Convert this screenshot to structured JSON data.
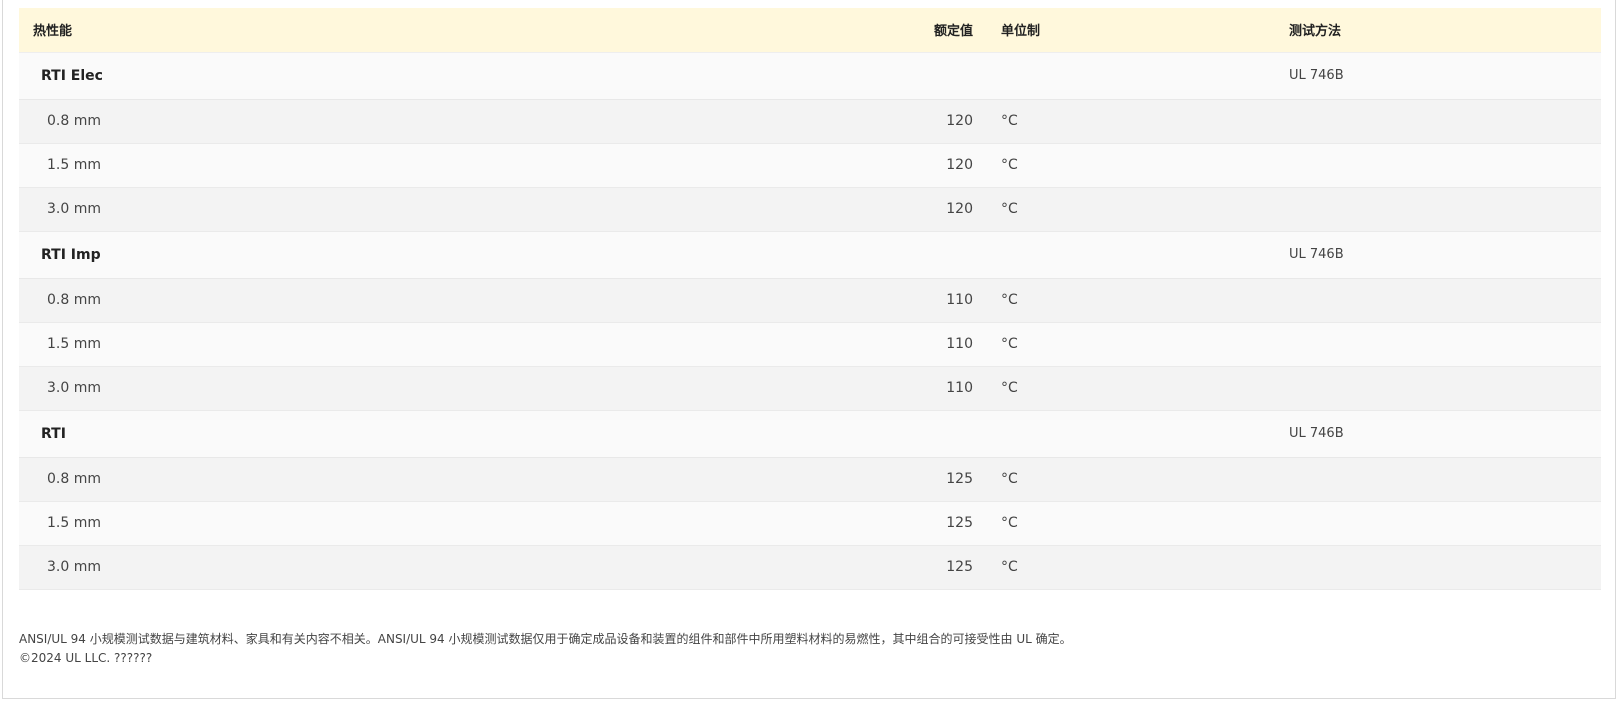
{
  "table": {
    "headers": {
      "property": "热性能",
      "value": "额定值",
      "unit": "单位制",
      "method": "测试方法"
    },
    "groups": [
      {
        "name": "RTI Elec",
        "method": "UL 746B",
        "rows": [
          {
            "name": "0.8 mm",
            "value": "120",
            "unit": "°C"
          },
          {
            "name": "1.5 mm",
            "value": "120",
            "unit": "°C"
          },
          {
            "name": "3.0 mm",
            "value": "120",
            "unit": "°C"
          }
        ]
      },
      {
        "name": "RTI Imp",
        "method": "UL 746B",
        "rows": [
          {
            "name": "0.8 mm",
            "value": "110",
            "unit": "°C"
          },
          {
            "name": "1.5 mm",
            "value": "110",
            "unit": "°C"
          },
          {
            "name": "3.0 mm",
            "value": "110",
            "unit": "°C"
          }
        ]
      },
      {
        "name": "RTI",
        "method": "UL 746B",
        "rows": [
          {
            "name": "0.8 mm",
            "value": "125",
            "unit": "°C"
          },
          {
            "name": "1.5 mm",
            "value": "125",
            "unit": "°C"
          },
          {
            "name": "3.0 mm",
            "value": "125",
            "unit": "°C"
          }
        ]
      }
    ]
  },
  "footer": {
    "disclaimer": "ANSI/UL 94 小规模测试数据与建筑材料、家具和有关内容不相关。ANSI/UL 94 小规模测试数据仅用于确定成品设备和装置的组件和部件中所用塑料材料的易燃性，其中组合的可接受性由 UL 确定。",
    "copyright": "©2024 UL LLC. ??????"
  }
}
